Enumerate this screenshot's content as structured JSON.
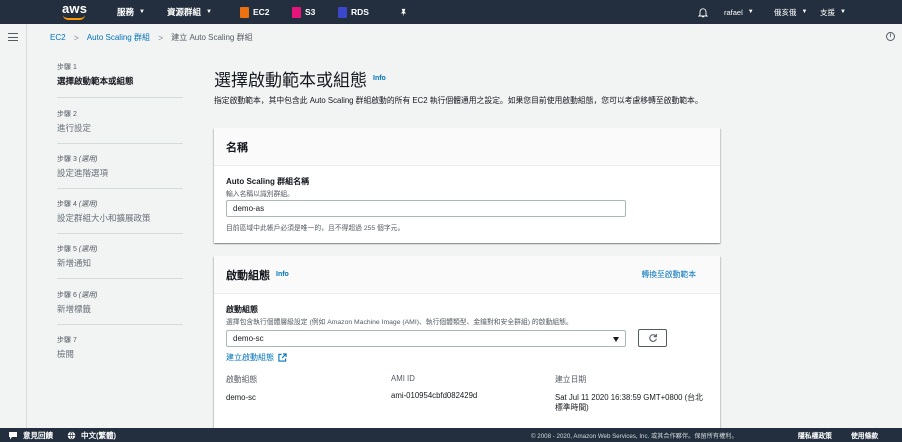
{
  "topnav": {
    "logo_text": "aws",
    "services": "服務",
    "resource_groups": "資源群組",
    "pins": [
      {
        "label": "EC2",
        "color": "#ec7211"
      },
      {
        "label": "S3",
        "color": "#e7157b"
      },
      {
        "label": "RDS",
        "color": "#3b48cc"
      }
    ],
    "user": "rafael",
    "region": "俄亥俄",
    "support": "支援"
  },
  "breadcrumb": {
    "items": [
      "EC2",
      "Auto Scaling 群組",
      "建立 Auto Scaling 群組"
    ]
  },
  "steps": [
    {
      "num": "步驟 1",
      "optional": "",
      "title": "選擇啟動範本或組態",
      "active": true
    },
    {
      "num": "步驟 2",
      "optional": "",
      "title": "進行設定",
      "active": false
    },
    {
      "num": "步驟 3",
      "optional": "(選用)",
      "title": "設定進階選項",
      "active": false
    },
    {
      "num": "步驟 4",
      "optional": "(選用)",
      "title": "設定群組大小和擴展政策",
      "active": false
    },
    {
      "num": "步驟 5",
      "optional": "(選用)",
      "title": "新增通知",
      "active": false
    },
    {
      "num": "步驟 6",
      "optional": "(選用)",
      "title": "新增標籤",
      "active": false
    },
    {
      "num": "步驟 7",
      "optional": "",
      "title": "檢閱",
      "active": false
    }
  ],
  "main": {
    "title": "選擇啟動範本或組態",
    "info": "Info",
    "description": "指定啟動範本，其中包含此 Auto Scaling 群組啟動的所有 EC2 執行個體通用之設定。如果您目前使用啟動組態，您可以考慮移轉至啟動範本。",
    "name_panel": {
      "header": "名稱",
      "field_label": "Auto Scaling 群組名稱",
      "field_sub": "輸入名稱以識別群組。",
      "field_value": "demo-as",
      "hint": "目前區域中此帳戶必須是唯一的，且不得超過 255 個字元。"
    },
    "launch_panel": {
      "header": "啟動組態",
      "info": "Info",
      "switch_link": "轉換至啟動範本",
      "field_label": "啟動組態",
      "field_sub": "選擇包含執行個體層級設定 (例如 Amazon Machine Image (AMI)、執行個體類型、金鑰對和安全群組) 的啟動組態。",
      "selected": "demo-sc",
      "create_link": "建立啟動組態",
      "columns": [
        {
          "header": "啟動組態",
          "value": "demo-sc"
        },
        {
          "header": "AMI ID",
          "value": "ami-010954cbfd082429d"
        },
        {
          "header": "建立日期",
          "value": "Sat Jul 11 2020 16:38:59 GMT+0800 (台北標準時間)"
        }
      ]
    }
  },
  "footer": {
    "feedback": "意見回饋",
    "language": "中文(繁體)",
    "copyright": "© 2008 - 2020, Amazon Web Services, Inc. 或其合作夥伴。保留所有權利。",
    "privacy": "隱私權政策",
    "terms": "使用條款"
  }
}
